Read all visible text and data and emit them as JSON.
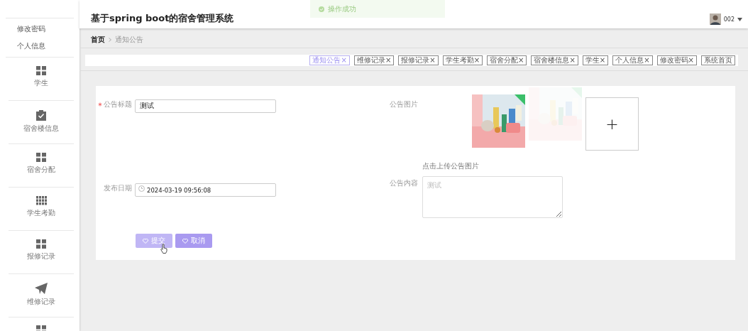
{
  "sidebar": {
    "top_links": [
      {
        "label": "修改密码"
      },
      {
        "label": "个人信息"
      }
    ],
    "items": [
      {
        "kind": "grid4",
        "label": "学生"
      },
      {
        "kind": "clipboard",
        "label": "宿舍楼信息"
      },
      {
        "kind": "grid4",
        "label": "宿舍分配"
      },
      {
        "kind": "grid9",
        "label": "学生考勤"
      },
      {
        "kind": "grid4",
        "label": "报修记录"
      },
      {
        "kind": "plane",
        "label": "维修记录"
      },
      {
        "kind": "grid4"
      }
    ]
  },
  "header": {
    "title": "基于spring boot的宿舍管理系统",
    "toast": "操作成功",
    "user": "002"
  },
  "breadcrumb": [
    "首页",
    "通知公告"
  ],
  "tabs": [
    {
      "label": "通知公告",
      "close": "×",
      "selected": true
    },
    {
      "label": "维修记录",
      "close": "×",
      "selected": false
    },
    {
      "label": "报修记录",
      "close": "×",
      "selected": false
    },
    {
      "label": "学生考勤",
      "close": "×",
      "selected": false
    },
    {
      "label": "宿舍分配",
      "close": "×",
      "selected": false
    },
    {
      "label": "宿舍楼信息",
      "close": "×",
      "selected": false
    },
    {
      "label": "学生",
      "close": "×",
      "selected": false
    },
    {
      "label": "个人信息",
      "close": "×",
      "selected": false
    },
    {
      "label": "修改密码",
      "close": "×",
      "selected": false
    },
    {
      "label": "系统首页",
      "selected": false
    }
  ],
  "form": {
    "title_field": {
      "label": "公告标题",
      "required": true,
      "value": "测试"
    },
    "date_field": {
      "label": "发布日期",
      "value": "2024-03-19 09:56:08"
    },
    "picture_field": {
      "label": "公告图片",
      "images": [
        {
          "kind": "picture",
          "faded": false
        },
        {
          "kind": "picture",
          "faded": true
        }
      ],
      "upload": "+",
      "hint": "点击上传公告图片"
    },
    "content_field": {
      "label": "公告内容",
      "placeholder": "测试"
    },
    "buttons": [
      {
        "label": "提交",
        "hovered": true
      },
      {
        "label": "取消",
        "hovered": false
      }
    ]
  }
}
